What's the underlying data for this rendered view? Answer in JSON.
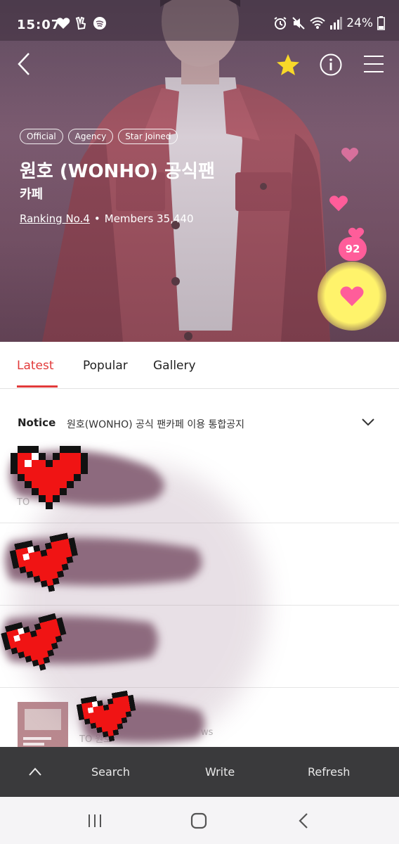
{
  "status_bar": {
    "time": "15:07",
    "battery": "24%",
    "left_icons": [
      "heart-icon",
      "peace-hand-icon",
      "spotify-icon"
    ],
    "right_icons": [
      "alarm-icon",
      "mute-icon",
      "wifi-icon",
      "signal-icon",
      "battery-icon"
    ]
  },
  "header": {
    "back_icon": "chevron-left-icon",
    "favorite_icon": "star-icon",
    "info_icon": "info-icon",
    "menu_icon": "hamburger-menu-icon",
    "favorite_color": "#f8d829"
  },
  "cafe": {
    "tags": [
      "Official",
      "Agency",
      "Star Joined"
    ],
    "title": "원호 (WONHO) 공식팬",
    "subtitle": "카페",
    "ranking": "Ranking No.4",
    "separator": "•",
    "members": "Members 35,440",
    "like_count": "92"
  },
  "tabs": [
    {
      "label": "Latest",
      "active": true
    },
    {
      "label": "Popular",
      "active": false
    },
    {
      "label": "Gallery",
      "active": false
    }
  ],
  "notice": {
    "label": "Notice",
    "text": "원호(WONHO) 공식 팬카페 이용 통합공지"
  },
  "posts": [
    {
      "meta": "TO"
    },
    {
      "meta": ""
    },
    {
      "meta": ""
    },
    {
      "meta": "TO 원호",
      "meta_right": "ws"
    }
  ],
  "bottom_bar": {
    "collapse_icon": "chevron-up-icon",
    "search": "Search",
    "write": "Write",
    "refresh": "Refresh"
  },
  "system_nav": [
    "recent-apps-icon",
    "home-icon",
    "back-icon"
  ],
  "colors": {
    "accent": "#e23a3a",
    "like_badge": "#ff5d9a",
    "like_button": "#fff36b",
    "bottom_bar": "#3a3a3c"
  }
}
